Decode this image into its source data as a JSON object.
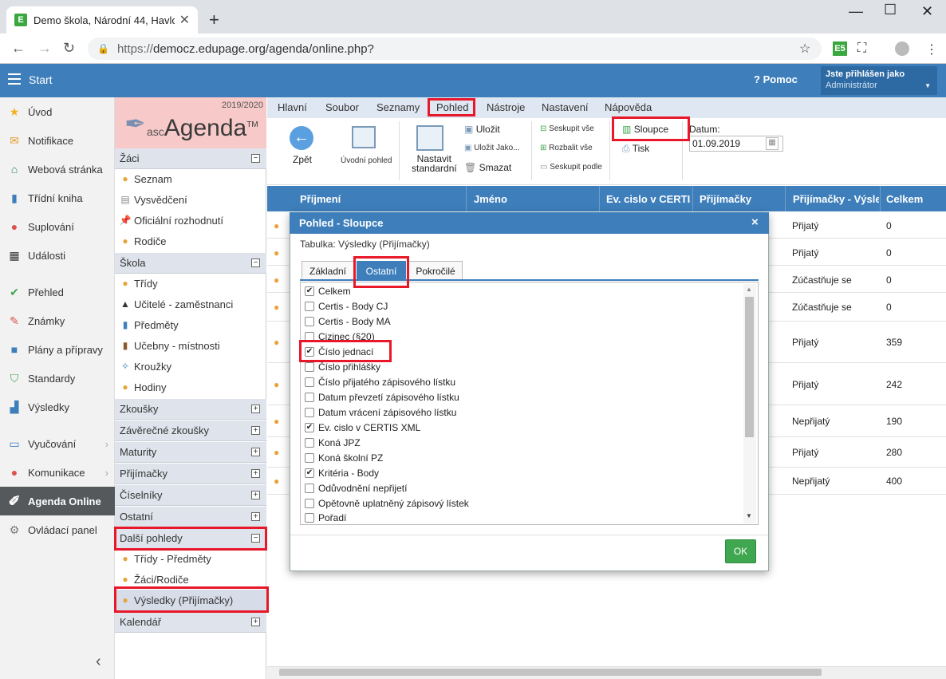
{
  "browser": {
    "tab_title": "Demo škola, Národní 44, Havlov",
    "tab_favicon": "E",
    "url_scheme": "https://",
    "url_rest": "democz.edupage.org/agenda/online.php?"
  },
  "topbar": {
    "start": "Start",
    "help": "Pomoc",
    "user_line1": "Jste přihlášen jako",
    "user_line2": "Administrátor"
  },
  "leftnav": [
    {
      "label": "Úvod",
      "icon": "star-icon"
    },
    {
      "label": "Notifikace",
      "icon": "envelope-icon"
    },
    {
      "label": "Webová stránka",
      "icon": "house-icon"
    },
    {
      "label": "Třídní kniha",
      "icon": "book-icon"
    },
    {
      "label": "Suplování",
      "icon": "person-icon"
    },
    {
      "label": "Události",
      "icon": "calendar-icon"
    },
    {
      "label": "Přehled",
      "icon": "check-circle-icon"
    },
    {
      "label": "Známky",
      "icon": "grades-icon"
    },
    {
      "label": "Plány a přípravy",
      "icon": "briefcase-icon"
    },
    {
      "label": "Standardy",
      "icon": "shield-icon"
    },
    {
      "label": "Výsledky",
      "icon": "bar-chart-icon"
    },
    {
      "label": "Vyučování",
      "icon": "laptop-icon"
    },
    {
      "label": "Komunikace",
      "icon": "chat-icon"
    },
    {
      "label": "Agenda Online",
      "icon": "pen-icon"
    },
    {
      "label": "Ovládací panel",
      "icon": "gear-icon"
    }
  ],
  "agenda": {
    "year": "2019/2020",
    "logo_small": "asc",
    "logo_big": "Agenda",
    "logo_tm": "TM",
    "sections": {
      "zaci": "Žáci",
      "skola": "Škola",
      "zkousky": "Zkoušky",
      "zaverecne": "Závěrečné zkoušky",
      "maturity": "Maturity",
      "prijimacky": "Přijímačky",
      "ciselniky": "Číselníky",
      "ostatni": "Ostatní",
      "dalsi": "Další pohledy",
      "kalendar": "Kalendář"
    },
    "items": {
      "seznam": "Seznam",
      "vysvedceni": "Vysvědčení",
      "rozhodnuti": "Oficiální rozhodnutí",
      "rodice": "Rodiče",
      "tridy": "Třídy",
      "ucitele": "Učitelé - zaměstnanci",
      "predmety": "Předměty",
      "ucebny": "Učebny - místnosti",
      "krouzky": "Kroužky",
      "hodiny": "Hodiny",
      "tridy_predmety": "Třídy - Předměty",
      "zaci_rodice": "Žáci/Rodiče",
      "vysledky": "Výsledky (Přijímačky)"
    }
  },
  "menu": [
    "Hlavní",
    "Soubor",
    "Seznamy",
    "Pohled",
    "Nástroje",
    "Nastavení",
    "Nápověda"
  ],
  "ribbon": {
    "zpet": "Zpět",
    "uvodni": "Úvodní pohled",
    "nastavit1": "Nastavit",
    "nastavit2": "standardní",
    "ulozit": "Uložit",
    "ulozit_jako": "Uložit Jako...",
    "smazat": "Smazat",
    "seskupit_vse": "Seskupit vše",
    "rozbalit_vse": "Rozbalit vše",
    "seskupit_podle": "Seskupit podle",
    "sloupce": "Sloupce",
    "tisk": "Tisk",
    "datum_label": "Datum:",
    "datum": "01.09.2019"
  },
  "grid": {
    "headers": [
      "Příjmení",
      "Jméno",
      "Ev. cislo v CERTIS",
      "Přijímačky",
      "Přijímačky - Výsled",
      "Celkem"
    ],
    "rows": [
      {
        "result": "Přijatý",
        "total": "0"
      },
      {
        "result": "Přijatý",
        "total": "0"
      },
      {
        "result": "Zúčastňuje se",
        "total": "0"
      },
      {
        "result": "Zúčastňuje se",
        "total": "0"
      },
      {
        "result": "Přijatý",
        "total": "359"
      },
      {
        "result": "Přijatý",
        "total": "242"
      },
      {
        "result": "Nepřijatý",
        "total": "190"
      },
      {
        "result": "Přijatý",
        "total": "280"
      },
      {
        "result": "Nepřijatý",
        "total": "400"
      }
    ]
  },
  "dialog": {
    "title": "Pohled - Sloupce",
    "close": "×",
    "tabulka": "Tabulka: Výsledky (Přijímačky)",
    "tabs": [
      "Základní",
      "Ostatní",
      "Pokročilé"
    ],
    "active_tab": "Ostatní",
    "columns": [
      {
        "label": "Celkem",
        "checked": true
      },
      {
        "label": "Certis - Body CJ",
        "checked": false
      },
      {
        "label": "Certis - Body MA",
        "checked": false
      },
      {
        "label": "Cizinec (§20)",
        "checked": false
      },
      {
        "label": "Číslo jednací",
        "checked": true
      },
      {
        "label": "Číslo přihlášky",
        "checked": false
      },
      {
        "label": "Číslo přijatého zápisového lístku",
        "checked": false
      },
      {
        "label": "Datum převzetí zápisového lístku",
        "checked": false
      },
      {
        "label": "Datum vrácení zápisového lístku",
        "checked": false
      },
      {
        "label": "Ev. cislo v CERTIS XML",
        "checked": true
      },
      {
        "label": "Koná JPZ",
        "checked": false
      },
      {
        "label": "Koná školní PZ",
        "checked": false
      },
      {
        "label": "Kritéria - Body",
        "checked": true
      },
      {
        "label": "Odůvodnění nepřijetí",
        "checked": false
      },
      {
        "label": "Opětovně uplatněný zápisový lístek",
        "checked": false
      },
      {
        "label": "Pořadí",
        "checked": false
      }
    ],
    "ok": "OK"
  },
  "colors": {
    "accent": "#3e7fbb",
    "highlight": "#e8182a",
    "ok_green": "#3fa74f",
    "logo_bg": "#f7c9c9"
  }
}
